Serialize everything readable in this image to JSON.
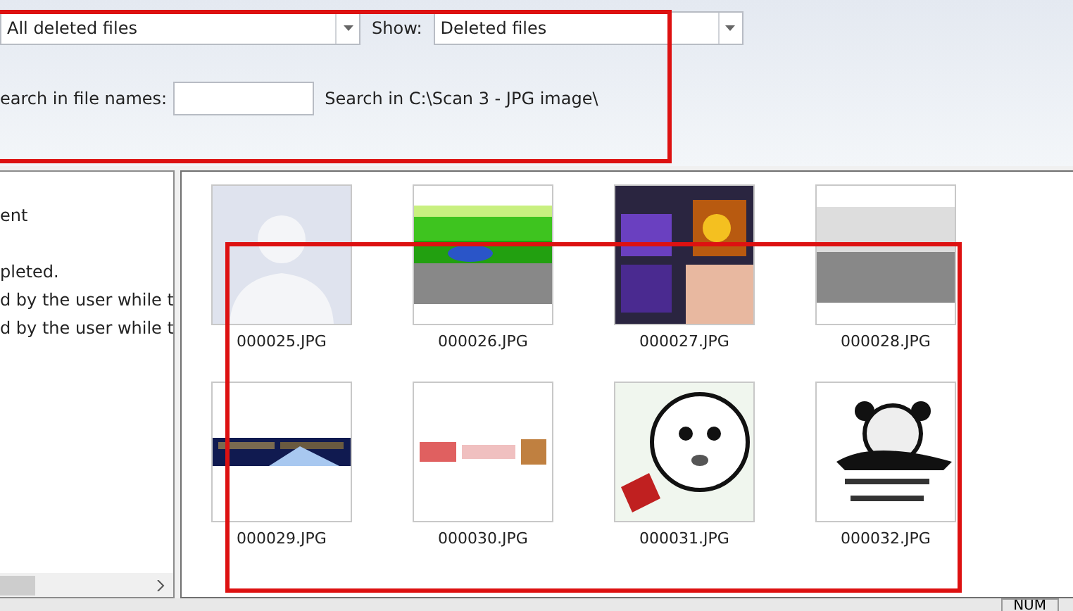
{
  "filter": {
    "value": "All deleted files"
  },
  "show": {
    "label": "Show:",
    "value": "Deleted files"
  },
  "search": {
    "label": "earch in file names:",
    "path": "Search in C:\\Scan 3 - JPG image\\"
  },
  "log": [
    "ent",
    "pleted.",
    "d by the user while t",
    "d by the user while t"
  ],
  "thumbnails": [
    {
      "name": "000025.JPG"
    },
    {
      "name": "000026.JPG"
    },
    {
      "name": "000027.JPG"
    },
    {
      "name": "000028.JPG"
    },
    {
      "name": "000029.JPG"
    },
    {
      "name": "000030.JPG"
    },
    {
      "name": "000031.JPG"
    },
    {
      "name": "000032.JPG"
    }
  ],
  "status_bar": {
    "indicator": "NUM"
  }
}
